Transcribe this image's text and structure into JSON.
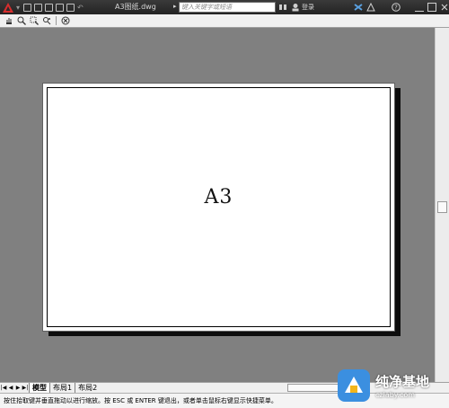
{
  "title_bar": {
    "document_title": "A3图纸.dwg",
    "search_placeholder": "键入关键字或短语",
    "login_label": "登录",
    "icons": [
      "app-logo",
      "new",
      "open",
      "save",
      "save-as",
      "print",
      "undo",
      "search",
      "user",
      "exchange",
      "help"
    ]
  },
  "nav_toolbar": {
    "icons": [
      "pan-icon",
      "zoom-realtime-icon",
      "zoom-window-icon",
      "orbit-icon",
      "close-circle-icon"
    ]
  },
  "layout": {
    "paper_label": "A3"
  },
  "tabs": {
    "items": [
      {
        "label": "模型",
        "active": true
      },
      {
        "label": "布局1",
        "active": false
      },
      {
        "label": "布局2",
        "active": false
      }
    ]
  },
  "status_bar": {
    "prompt": "按住拾取键并垂直拖动以进行缩放。按 ESC 或 ENTER 键退出，或者单击鼠标右键显示快捷菜单。"
  },
  "watermark": {
    "title": "纯净基地",
    "url": "czlaby.com"
  },
  "colors": {
    "workspace": "#808080",
    "titlebar": "#2b2b2b",
    "app_logo": "#d62e2e",
    "paper": "#ffffff",
    "watermark_accent": "#3b8fe0"
  }
}
